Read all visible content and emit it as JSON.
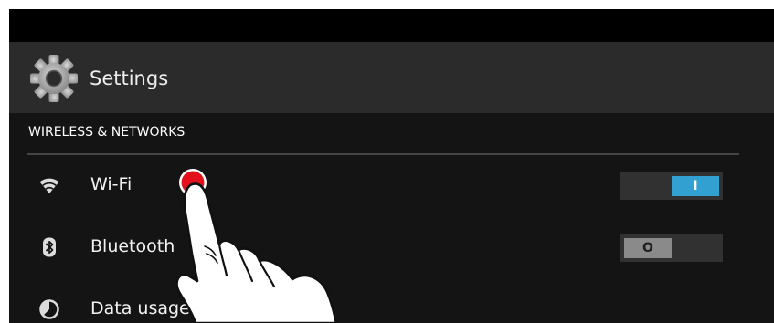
{
  "action_bar": {
    "title": "Settings",
    "icon": "gear-icon"
  },
  "section": {
    "header": "WIRELESS & NETWORKS"
  },
  "rows": [
    {
      "label": "Wi-Fi",
      "icon": "wifi-icon",
      "toggle": {
        "state": "on",
        "label": "I"
      }
    },
    {
      "label": "Bluetooth",
      "icon": "bluetooth-icon",
      "toggle": {
        "state": "off",
        "label": "O"
      }
    },
    {
      "label": "Data usage",
      "icon": "data-usage-icon"
    }
  ],
  "overlay": {
    "icon": "pointing-hand-icon",
    "touch_color": "#e3101c"
  },
  "colors": {
    "accent": "#33a0d2",
    "background": "#141414",
    "action_bar": "#2b2b2b"
  }
}
